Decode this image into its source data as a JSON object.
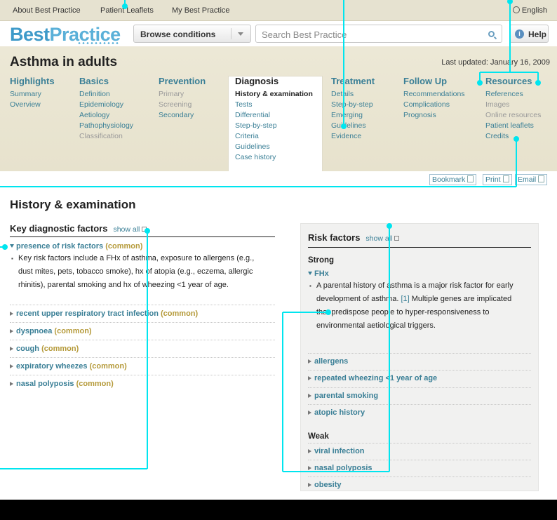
{
  "topbar": {
    "about": "About Best Practice",
    "leaflets": "Patient Leaflets",
    "my_bp": "My Best Practice",
    "language": "English"
  },
  "brand": {
    "logo_part1": "Best",
    "logo_part2": "Practice",
    "browse_label": "Browse conditions",
    "search_placeholder": "Search Best Practice",
    "help_label": "Help"
  },
  "page": {
    "title": "Asthma in adults",
    "updated": "Last updated: January 16, 2009"
  },
  "nav": {
    "highlights": {
      "head": "Highlights",
      "items": [
        "Summary",
        "Overview"
      ]
    },
    "basics": {
      "head": "Basics",
      "items": [
        "Definition",
        "Epidemiology",
        "Aetiology",
        "Pathophysiology",
        "Classification"
      ]
    },
    "prevention": {
      "head": "Prevention",
      "items": [
        "Primary",
        "Screening",
        "Secondary"
      ]
    },
    "diagnosis": {
      "head": "Diagnosis",
      "items": [
        "History & examination",
        "Tests",
        "Differential",
        "Step-by-step",
        "Criteria",
        "Guidelines",
        "Case history"
      ]
    },
    "treatment": {
      "head": "Treatment",
      "items": [
        "Details",
        "Step-by-step",
        "Emerging",
        "Guidelines",
        "Evidence"
      ]
    },
    "followup": {
      "head": "Follow Up",
      "items": [
        "Recommendations",
        "Complications",
        "Prognosis"
      ]
    },
    "resources": {
      "head": "Resources",
      "items": [
        "References",
        "Images",
        "Online resources",
        "Patient leaflets",
        "Credits"
      ]
    }
  },
  "actions": {
    "bookmark": "Bookmark",
    "print": "Print",
    "email": "Email"
  },
  "main": {
    "title": "History & examination",
    "key_factors": {
      "heading": "Key diagnostic factors",
      "show_all": "show all",
      "open_factor": {
        "name": "presence of risk factors",
        "freq": "(common)",
        "lines": [
          "Key risk factors include a FHx of asthma, exposure to allergens (e.g.,",
          "dust mites, pets, tobacco smoke), hx of atopia (e.g., eczema, allergic",
          "rhinitis), parental smoking and hx of wheezing <1 year of age."
        ]
      },
      "rows": [
        {
          "name": "recent upper respiratory tract infection",
          "freq": "(common)"
        },
        {
          "name": "dyspnoea",
          "freq": "(common)"
        },
        {
          "name": "cough",
          "freq": "(common)"
        },
        {
          "name": "expiratory wheezes",
          "freq": "(common)"
        },
        {
          "name": "nasal polyposis",
          "freq": "(common)"
        }
      ]
    },
    "risk_factors": {
      "heading": "Risk factors",
      "show_all": "show all",
      "strong_label": "Strong",
      "open_factor": {
        "name": "FHx",
        "lines_pre": "A parental history of asthma is a major risk factor for early",
        "line2_pre": "development of asthma.",
        "ref": "[1]",
        "line2_post": "Multiple genes are implicated",
        "line3": "that predispose people to hyper-responsiveness to",
        "line4": "environmental aetiological triggers."
      },
      "strong_rows": [
        "allergens",
        "repeated wheezing <1 year of age",
        "parental smoking",
        "atopic history"
      ],
      "weak_label": "Weak",
      "weak_rows": [
        "viral infection",
        "nasal polyposis",
        "obesity"
      ]
    }
  },
  "colors": {
    "accent_teal": "#3a7f96",
    "freq_gold": "#b59a3a",
    "annotation_cyan": "#00e5ef",
    "band_beige": "#ece8d6"
  }
}
